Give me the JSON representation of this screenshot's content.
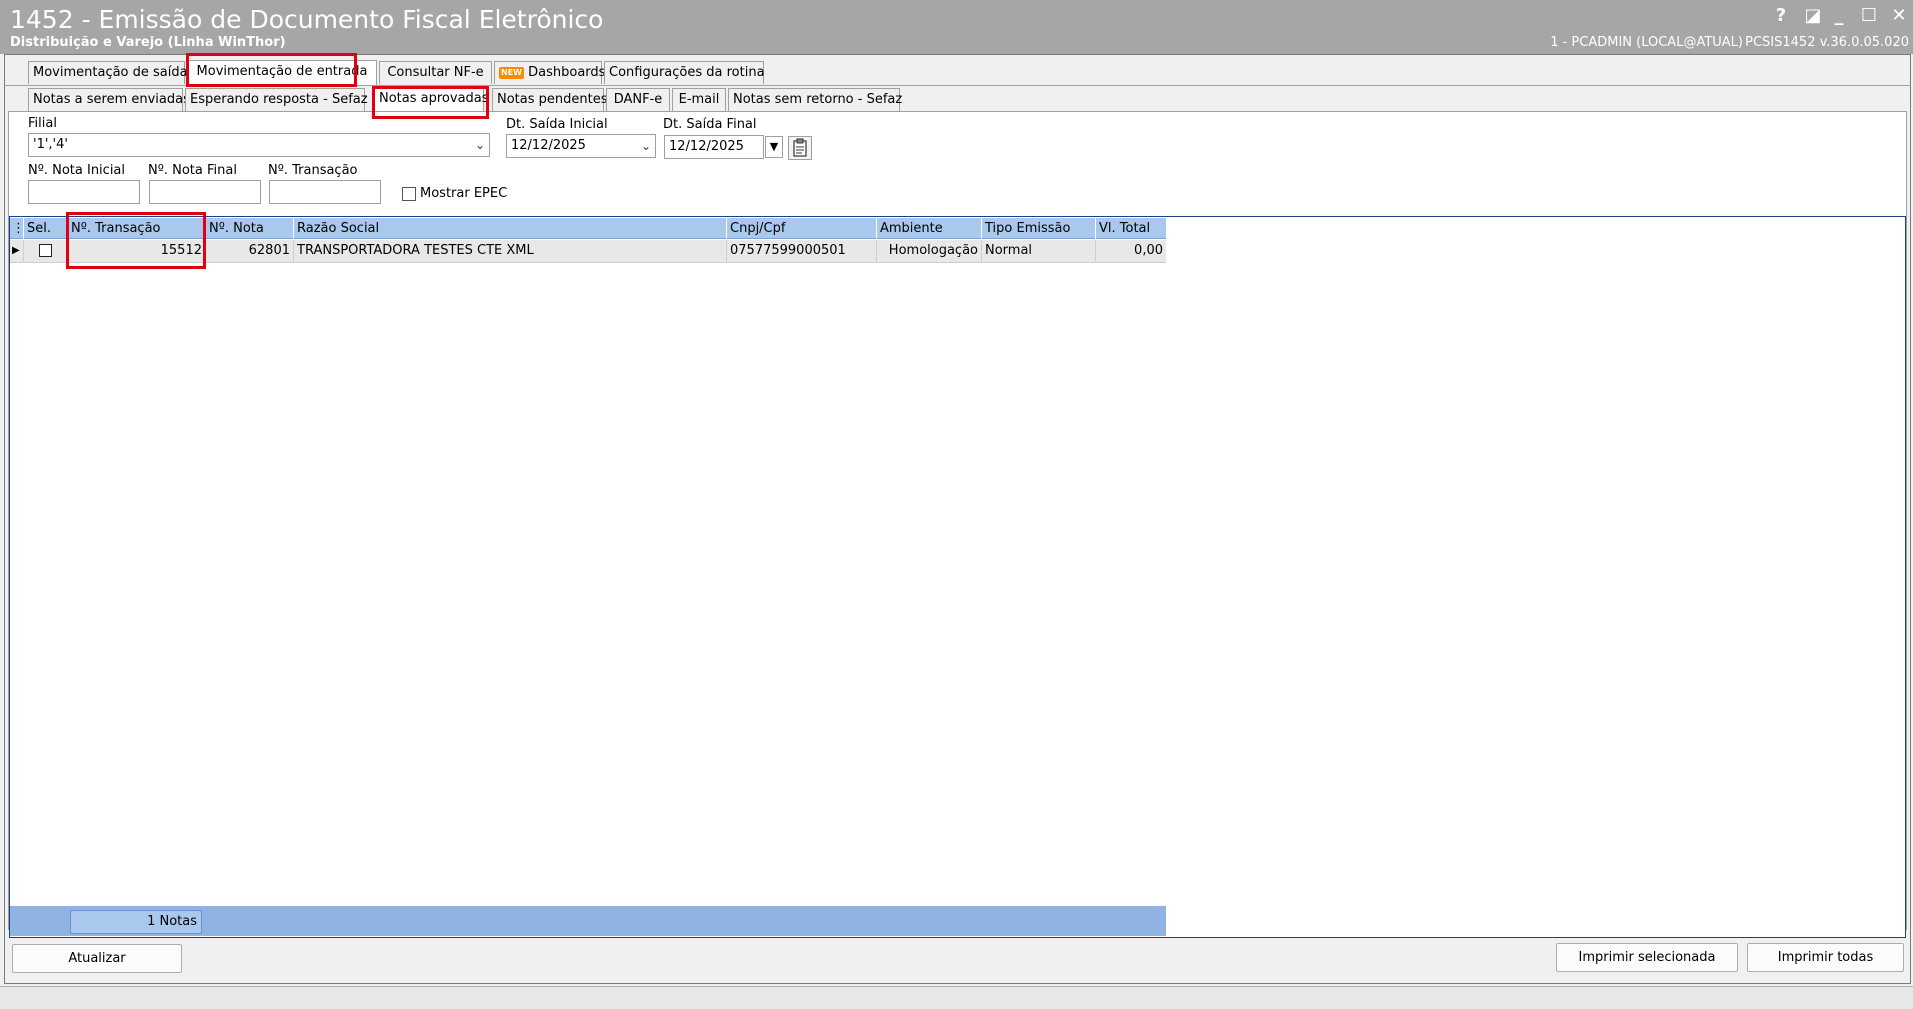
{
  "window": {
    "title": "1452 - Emissão de Documento Fiscal Eletrônico",
    "subtitle": "Distribuição e Varejo (Linha WinThor)",
    "user_info": "1 - PCADMIN (LOCAL@ATUAL)",
    "version_info": "PCSIS1452  v.36.0.05.020",
    "controls": {
      "help": "?",
      "restore_small": "◪",
      "minimize": "_",
      "maximize": "☐",
      "close": "✕"
    }
  },
  "tabs_top": [
    {
      "label": "Movimentação de saída"
    },
    {
      "label": "Movimentação de entrada",
      "active": true
    },
    {
      "label": "Consultar NF-e"
    },
    {
      "label": "Dashboards",
      "badge": "NEW"
    },
    {
      "label": "Configurações da rotina"
    }
  ],
  "tabs_sub": [
    {
      "label": "Notas a serem enviadas"
    },
    {
      "label": "Esperando resposta - Sefaz"
    },
    {
      "label": "Notas aprovadas",
      "active": true
    },
    {
      "label": "Notas pendentes"
    },
    {
      "label": "DANF-e"
    },
    {
      "label": "E-mail"
    },
    {
      "label": "Notas sem retorno - Sefaz"
    }
  ],
  "filters": {
    "filial_label": "Filial",
    "filial_value": "'1','4'",
    "dt_saida_inicial_label": "Dt. Saída Inicial",
    "dt_saida_inicial_value": "12/12/2025",
    "dt_saida_final_label": "Dt. Saída Final",
    "dt_saida_final_value": "12/12/2025",
    "nota_inicial_label": "Nº. Nota Inicial",
    "nota_inicial_value": "",
    "nota_final_label": "Nº. Nota Final",
    "nota_final_value": "",
    "transacao_label": "Nº. Transação",
    "transacao_value": "",
    "mostrar_epec_label": "Mostrar EPEC",
    "mostrar_epec_checked": false
  },
  "grid": {
    "columns": [
      "Sel.",
      "Nº. Transação",
      "Nº. Nota",
      "Razão Social",
      "Cnpj/Cpf",
      "Ambiente",
      "Tipo Emissão",
      "Vl. Total"
    ],
    "rows": [
      {
        "sel": false,
        "transacao": "15512",
        "nota": "62801",
        "razao_social": "TRANSPORTADORA TESTES CTE XML",
        "cnpj_cpf": "07577599000501",
        "ambiente": "Homologação",
        "tipo_emissao": "Normal",
        "vl_total": "0,00"
      }
    ],
    "footer_count": "1 Notas"
  },
  "buttons": {
    "atualizar": "Atualizar",
    "imprimir_selecionada": "Imprimir selecionada",
    "imprimir_todas": "Imprimir todas"
  },
  "colors": {
    "titlebar": "#a6a6a6",
    "grid_header": "#a8c8ee",
    "grid_footer": "#8fb4e4",
    "highlight": "#e0000f"
  }
}
